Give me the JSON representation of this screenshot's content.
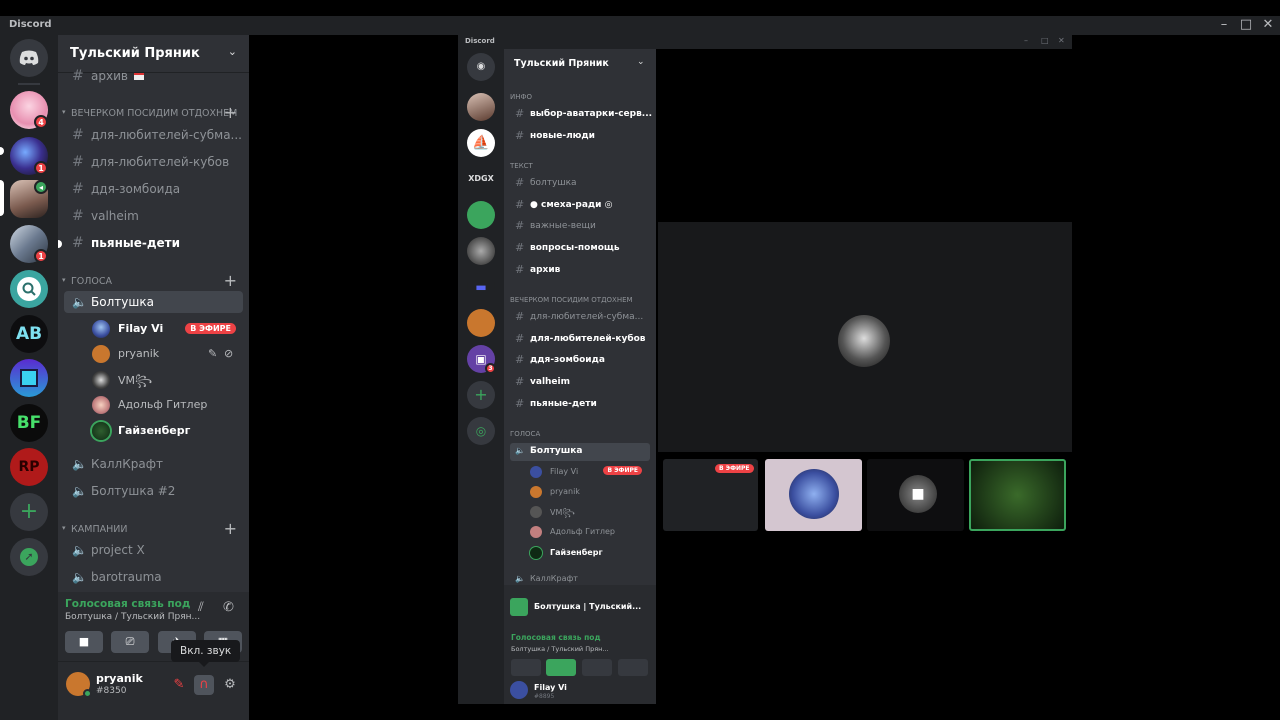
{
  "app": {
    "title": "Discord"
  },
  "servers": [
    {
      "name": "home",
      "badge": ""
    },
    {
      "name": "server-pink",
      "badge": "4"
    },
    {
      "name": "server-neon",
      "badge": "1"
    },
    {
      "name": "server-girl",
      "badge": ""
    },
    {
      "name": "server-gameart",
      "badge": "1"
    },
    {
      "name": "server-magnifier",
      "badge": ""
    },
    {
      "name": "server-ab",
      "badge": ""
    },
    {
      "name": "server-pixel",
      "badge": ""
    },
    {
      "name": "server-bf",
      "badge": ""
    },
    {
      "name": "server-rp",
      "badge": ""
    }
  ],
  "guild": {
    "name": "Тульский Пряник"
  },
  "channels": {
    "top_item": "архив",
    "cat_evening": "вечерком посидим отдохнем",
    "evening": [
      {
        "label": "для-любителей-субма...",
        "unread": false
      },
      {
        "label": "для-любителей-кубов",
        "unread": false
      },
      {
        "label": "ддя-зомбоида",
        "unread": false
      },
      {
        "label": "valheim",
        "unread": false
      },
      {
        "label": "пьяные-дети",
        "unread": true
      }
    ],
    "cat_voices": "голоса",
    "voice_active": "Болтушка",
    "voice_users": [
      {
        "name": "Filay Vi",
        "live": "В ЭФИРЕ"
      },
      {
        "name": "pryanik"
      },
      {
        "name": "VM꧂"
      },
      {
        "name": "Адольф Гитлер"
      },
      {
        "name": "Гайзенберг"
      }
    ],
    "voice_others": [
      "КаллКрафт",
      "Болтушка #2"
    ],
    "cat_campaigns": "кампании",
    "campaigns": [
      "project X",
      "barotrauma"
    ]
  },
  "voice_panel": {
    "status": "Голосовая связь под",
    "sub": "Болтушка / Тульский Прян..."
  },
  "user": {
    "name": "pryanik",
    "tag": "#8350"
  },
  "tooltip": "Вкл. звук",
  "inner": {
    "title": "Discord",
    "guild": "Тульский Пряник",
    "cat_info": "инфо",
    "info": [
      "выбор-аватарки-серв...",
      "новые-люди"
    ],
    "cat_text": "текст",
    "text": [
      "болтушка",
      "● смеха-ради ◎",
      "важные-вещи",
      "вопросы-помощь",
      "архив"
    ],
    "cat_evening": "вечерком посидим отдохнем",
    "evening": [
      "для-любителей-субма...",
      "для-любителей-кубов",
      "ддя-зомбоида",
      "valheim",
      "пьяные-дети"
    ],
    "cat_voices": "голоса",
    "voice": "Болтушка",
    "voice_users": [
      "Filay Vi",
      "pryanik",
      "VM꧂",
      "Адольф Гитлер",
      "Гайзенберг"
    ],
    "live": "В ЭФИРЕ",
    "next_voice": "КаллКрафт",
    "stream_label": "Болтушка | Тульский...",
    "voice_status": "Голосовая связь под",
    "voice_sub": "Болтушка / Тульский Прян...",
    "user": "Filay Vi",
    "user_tag": "#8895",
    "rail_labels": [
      "XDGX"
    ],
    "twitch_badge": "3",
    "tile_live": "В ЭФИРЕ"
  },
  "colors": {
    "green": "#3ba55d",
    "red": "#ed4245",
    "blurple": "#5865f2"
  }
}
